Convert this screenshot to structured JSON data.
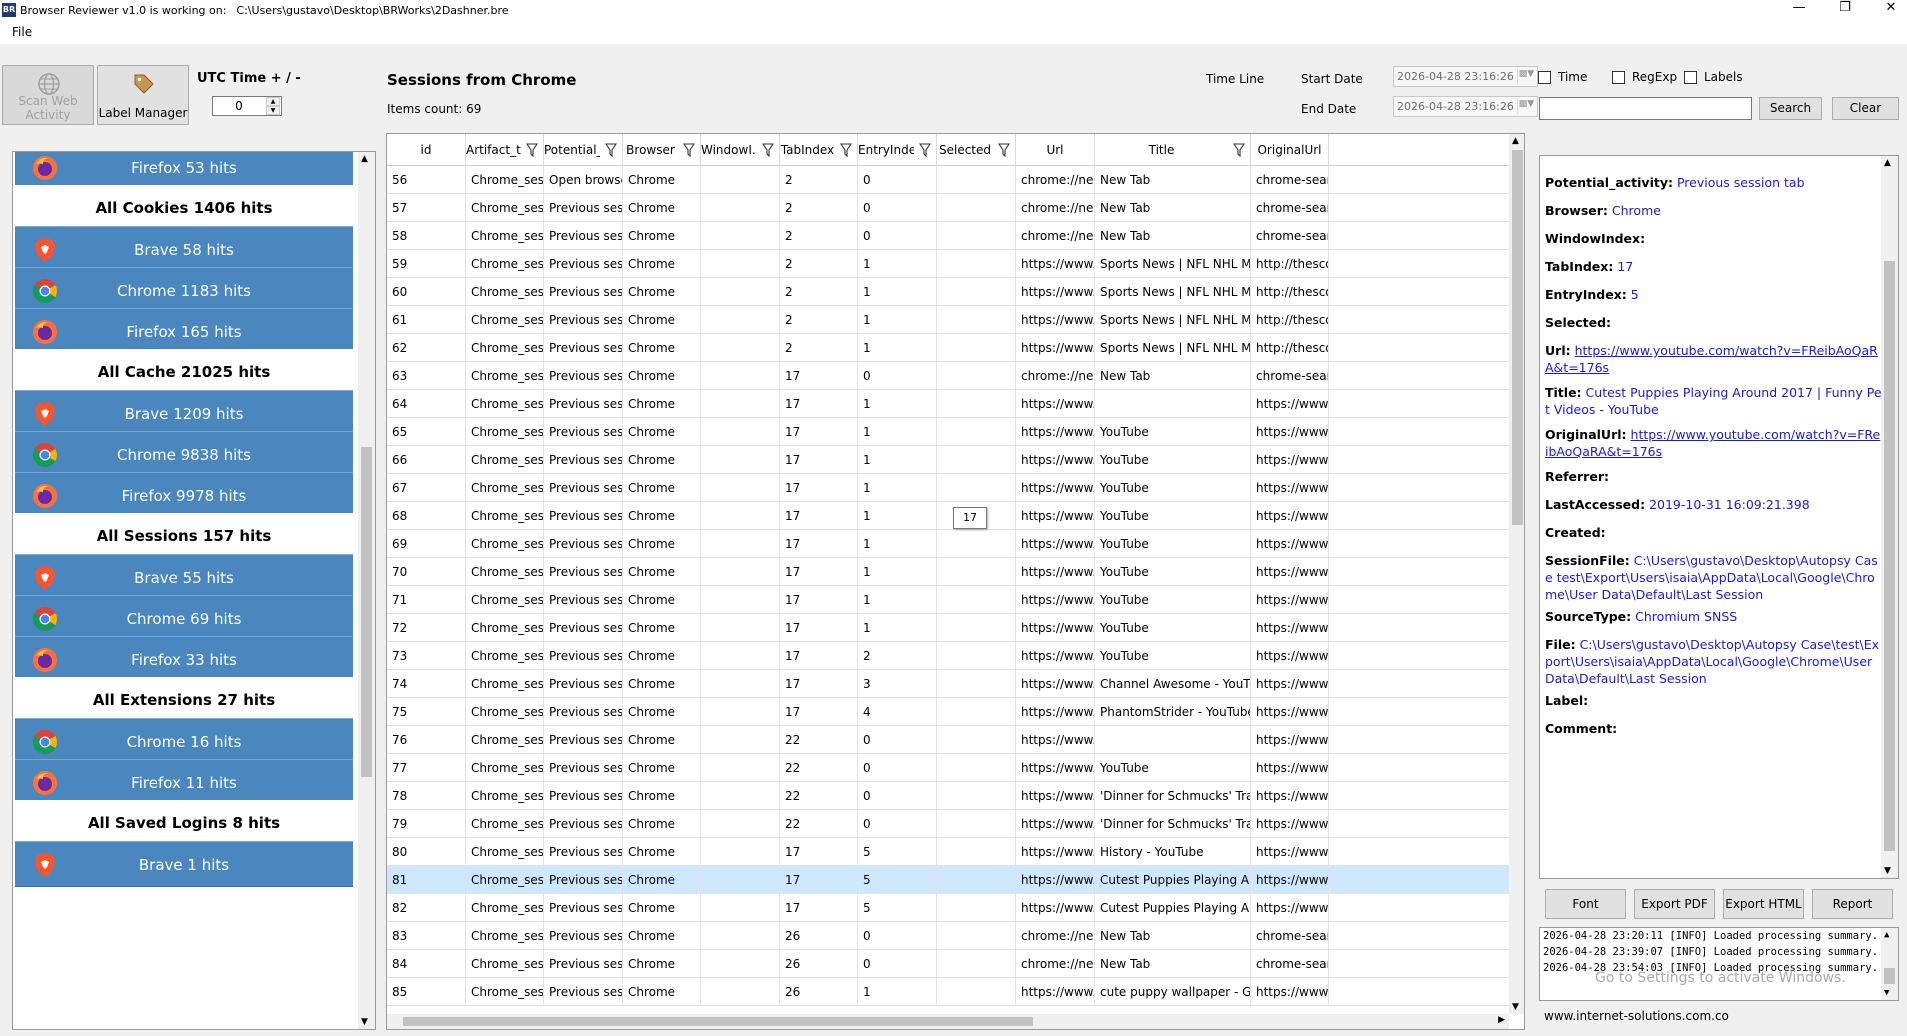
{
  "window": {
    "title": "Browser Reviewer v1.0 is working on:",
    "path": "C:\\Users\\gustavo\\Desktop\\BRWorks\\2Dashner.bre",
    "logo_text": "BR"
  },
  "menu": {
    "file": "File"
  },
  "toolbar": {
    "scan_label_1": "Scan Web",
    "scan_label_2": "Activity",
    "label_manager": "Label Manager",
    "utc_label": "UTC Time + / -",
    "utc_value": "0"
  },
  "sessions": {
    "title": "Sessions from Chrome",
    "items_count": "Items count: 69"
  },
  "filters": {
    "timeline": "Time Line",
    "start_date_label": "Start Date",
    "end_date_label": "End Date",
    "start_date": "2026-04-28 23:16:26",
    "end_date": "2026-04-28 23:16:26",
    "time": "Time",
    "regexp": "RegExp",
    "labels": "Labels",
    "search": "Search",
    "clear": "Clear"
  },
  "left_items": [
    {
      "type": "btn",
      "browser": "firefox",
      "label": "Firefox 53 hits"
    },
    {
      "type": "hdr",
      "label": "All Cookies 1406 hits"
    },
    {
      "type": "btn",
      "browser": "brave",
      "label": "Brave 58 hits"
    },
    {
      "type": "btn",
      "browser": "chrome",
      "label": "Chrome 1183 hits"
    },
    {
      "type": "btn",
      "browser": "firefox",
      "label": "Firefox 165 hits"
    },
    {
      "type": "hdr",
      "label": "All Cache 21025 hits"
    },
    {
      "type": "btn",
      "browser": "brave",
      "label": "Brave 1209 hits"
    },
    {
      "type": "btn",
      "browser": "chrome",
      "label": "Chrome 9838 hits"
    },
    {
      "type": "btn",
      "browser": "firefox",
      "label": "Firefox 9978 hits"
    },
    {
      "type": "hdr",
      "label": "All Sessions 157 hits"
    },
    {
      "type": "btn",
      "browser": "brave",
      "label": "Brave 55 hits"
    },
    {
      "type": "btn",
      "browser": "chrome",
      "label": "Chrome 69 hits"
    },
    {
      "type": "btn",
      "browser": "firefox",
      "label": "Firefox 33 hits"
    },
    {
      "type": "hdr",
      "label": "All Extensions 27 hits"
    },
    {
      "type": "btn",
      "browser": "chrome",
      "label": "Chrome 16 hits"
    },
    {
      "type": "btn",
      "browser": "firefox",
      "label": "Firefox 11 hits"
    },
    {
      "type": "hdr",
      "label": "All Saved Logins 8 hits"
    },
    {
      "type": "btn",
      "browser": "brave",
      "label": "Brave 1 hits"
    }
  ],
  "grid": {
    "columns": [
      "id",
      "Artifact_t...",
      "Potential_...",
      "Browser",
      "WindowI...",
      "TabIndex",
      "EntryIndex",
      "Selected",
      "Url",
      "Title",
      "OriginalUrl"
    ],
    "rows": [
      [
        "56",
        "Chrome_sessi...",
        "Open browser...",
        "Chrome",
        "",
        "2",
        "0",
        "",
        "chrome://new...",
        "New Tab",
        "chrome-sear"
      ],
      [
        "57",
        "Chrome_sessi...",
        "Previous sessi...",
        "Chrome",
        "",
        "2",
        "0",
        "",
        "chrome://new...",
        "New Tab",
        "chrome-sear"
      ],
      [
        "58",
        "Chrome_sessi...",
        "Previous sessi...",
        "Chrome",
        "",
        "2",
        "0",
        "",
        "chrome://new...",
        "New Tab",
        "chrome-sear"
      ],
      [
        "59",
        "Chrome_sessi...",
        "Previous sessi...",
        "Chrome",
        "",
        "2",
        "1",
        "",
        "https://www.t...",
        "Sports News | NFL NHL MLB N...",
        "http://thesco"
      ],
      [
        "60",
        "Chrome_sessi...",
        "Previous sessi...",
        "Chrome",
        "",
        "2",
        "1",
        "",
        "https://www.t...",
        "Sports News | NFL NHL MLB N...",
        "http://thesco"
      ],
      [
        "61",
        "Chrome_sessi...",
        "Previous sessi...",
        "Chrome",
        "",
        "2",
        "1",
        "",
        "https://www.t...",
        "Sports News | NFL NHL MLB N...",
        "http://thesco"
      ],
      [
        "62",
        "Chrome_sessi...",
        "Previous sessi...",
        "Chrome",
        "",
        "2",
        "1",
        "",
        "https://www.t...",
        "Sports News | NFL NHL MLB N...",
        "http://thesco"
      ],
      [
        "63",
        "Chrome_sessi...",
        "Previous sessi...",
        "Chrome",
        "",
        "17",
        "0",
        "",
        "chrome://new...",
        "New Tab",
        "chrome-sear"
      ],
      [
        "64",
        "Chrome_sessi...",
        "Previous sessi...",
        "Chrome",
        "",
        "17",
        "1",
        "",
        "https://www.y...",
        "",
        "https://www"
      ],
      [
        "65",
        "Chrome_sessi...",
        "Previous sessi...",
        "Chrome",
        "",
        "17",
        "1",
        "",
        "https://www.y...",
        "YouTube",
        "https://www"
      ],
      [
        "66",
        "Chrome_sessi...",
        "Previous sessi...",
        "Chrome",
        "",
        "17",
        "1",
        "",
        "https://www.y...",
        "YouTube",
        "https://www"
      ],
      [
        "67",
        "Chrome_sessi...",
        "Previous sessi...",
        "Chrome",
        "",
        "17",
        "1",
        "",
        "https://www.y...",
        "YouTube",
        "https://www"
      ],
      [
        "68",
        "Chrome_sessi...",
        "Previous sessi...",
        "Chrome",
        "",
        "17",
        "1",
        "",
        "https://www.y...",
        "YouTube",
        "https://www"
      ],
      [
        "69",
        "Chrome_sessi...",
        "Previous sessi...",
        "Chrome",
        "",
        "17",
        "1",
        "",
        "https://www.y...",
        "YouTube",
        "https://www"
      ],
      [
        "70",
        "Chrome_sessi...",
        "Previous sessi...",
        "Chrome",
        "",
        "17",
        "1",
        "",
        "https://www.y...",
        "YouTube",
        "https://www"
      ],
      [
        "71",
        "Chrome_sessi...",
        "Previous sessi...",
        "Chrome",
        "",
        "17",
        "1",
        "",
        "https://www.y...",
        "YouTube",
        "https://www"
      ],
      [
        "72",
        "Chrome_sessi...",
        "Previous sessi...",
        "Chrome",
        "",
        "17",
        "1",
        "",
        "https://www.y...",
        "YouTube",
        "https://www"
      ],
      [
        "73",
        "Chrome_sessi...",
        "Previous sessi...",
        "Chrome",
        "",
        "17",
        "2",
        "",
        "https://www.y...",
        "YouTube",
        "https://www"
      ],
      [
        "74",
        "Chrome_sessi...",
        "Previous sessi...",
        "Chrome",
        "",
        "17",
        "3",
        "",
        "https://www.y...",
        "Channel Awesome - YouTube",
        "https://www"
      ],
      [
        "75",
        "Chrome_sessi...",
        "Previous sessi...",
        "Chrome",
        "",
        "17",
        "4",
        "",
        "https://www.y...",
        "PhantomStrider - YouTube",
        "https://www"
      ],
      [
        "76",
        "Chrome_sessi...",
        "Previous sessi...",
        "Chrome",
        "",
        "22",
        "0",
        "",
        "https://www.y...",
        "",
        "https://www"
      ],
      [
        "77",
        "Chrome_sessi...",
        "Previous sessi...",
        "Chrome",
        "",
        "22",
        "0",
        "",
        "https://www.y...",
        "YouTube",
        "https://www"
      ],
      [
        "78",
        "Chrome_sessi...",
        "Previous sessi...",
        "Chrome",
        "",
        "22",
        "0",
        "",
        "https://www.y...",
        "'Dinner for Schmucks' Trailer H...",
        "https://www"
      ],
      [
        "79",
        "Chrome_sessi...",
        "Previous sessi...",
        "Chrome",
        "",
        "22",
        "0",
        "",
        "https://www.y...",
        "'Dinner for Schmucks' Trailer H...",
        "https://www"
      ],
      [
        "80",
        "Chrome_sessi...",
        "Previous sessi...",
        "Chrome",
        "",
        "17",
        "5",
        "",
        "https://www.y...",
        "History - YouTube",
        "https://www"
      ],
      [
        "81",
        "Chrome_sessi...",
        "Previous sessi...",
        "Chrome",
        "",
        "17",
        "5",
        "",
        "https://www.y...",
        "Cutest Puppies Playing Around...",
        "https://www"
      ],
      [
        "82",
        "Chrome_sessi...",
        "Previous sessi...",
        "Chrome",
        "",
        "17",
        "5",
        "",
        "https://www.y...",
        "Cutest Puppies Playing Around...",
        "https://www"
      ],
      [
        "83",
        "Chrome_sessi...",
        "Previous sessi...",
        "Chrome",
        "",
        "26",
        "0",
        "",
        "chrome://new...",
        "New Tab",
        "chrome-sear"
      ],
      [
        "84",
        "Chrome_sessi...",
        "Previous sessi...",
        "Chrome",
        "",
        "26",
        "0",
        "",
        "chrome://new...",
        "New Tab",
        "chrome-sear"
      ],
      [
        "85",
        "Chrome_sessi...",
        "Previous sessi...",
        "Chrome",
        "",
        "26",
        "1",
        "",
        "https://www.g...",
        "cute puppy wallpaper - Google...",
        "https://www"
      ]
    ],
    "selected_id": "81",
    "tooltip": "17"
  },
  "details": [
    {
      "label": "Potential_activity:",
      "value": "Previous session tab",
      "kind": "text"
    },
    {
      "label": "Browser:",
      "value": "Chrome",
      "kind": "text"
    },
    {
      "label": "WindowIndex:",
      "value": "",
      "kind": "text"
    },
    {
      "label": "TabIndex:",
      "value": "17",
      "kind": "text"
    },
    {
      "label": "EntryIndex:",
      "value": "5",
      "kind": "text"
    },
    {
      "label": "Selected:",
      "value": "",
      "kind": "text"
    },
    {
      "label": "Url:",
      "value": "https://www.youtube.com/watch?v=FReibAoQaRA&t=176s",
      "kind": "link"
    },
    {
      "label": "Title:",
      "value": "Cutest Puppies Playing Around 2017 | Funny Pet Videos - YouTube",
      "kind": "text"
    },
    {
      "label": "OriginalUrl:",
      "value": "https://www.youtube.com/watch?v=FReibAoQaRA&t=176s",
      "kind": "link"
    },
    {
      "label": "Referrer:",
      "value": "",
      "kind": "text"
    },
    {
      "label": "LastAccessed:",
      "value": "2019-10-31 16:09:21.398",
      "kind": "text"
    },
    {
      "label": "Created:",
      "value": "",
      "kind": "text"
    },
    {
      "label": "SessionFile:",
      "value": "C:\\Users\\gustavo\\Desktop\\Autopsy Case test\\Export\\Users\\isaia\\AppData\\Local\\Google\\Chrome\\User Data\\Default\\Last Session",
      "kind": "text"
    },
    {
      "label": "SourceType:",
      "value": "Chromium SNSS",
      "kind": "text"
    },
    {
      "label": "File:",
      "value": "C:\\Users\\gustavo\\Desktop\\Autopsy Case\\test\\Export\\Users\\isaia\\AppData\\Local\\Google\\Chrome\\User Data\\Default\\Last Session",
      "kind": "text"
    },
    {
      "label": "Label:",
      "value": "",
      "kind": "text"
    },
    {
      "label": "Comment:",
      "value": "",
      "kind": "text"
    }
  ],
  "detail_buttons": {
    "font": "Font",
    "export_pdf": "Export PDF",
    "export_html": "Export HTML",
    "report": "Report"
  },
  "log": [
    "2026-04-28 23:20:11 [INFO] Loaded processing summary.",
    "2026-04-28 23:39:07 [INFO] Loaded processing summary.",
    "2026-04-28 23:54:03 [INFO] Loaded processing summary."
  ],
  "watermark": "Go to Settings to activate Windows.",
  "website": "www.internet-solutions.com.co",
  "colors": {
    "panel_button": "#4a87bf",
    "selected_row": "#cde8ff",
    "link": "#1a1ad8"
  }
}
